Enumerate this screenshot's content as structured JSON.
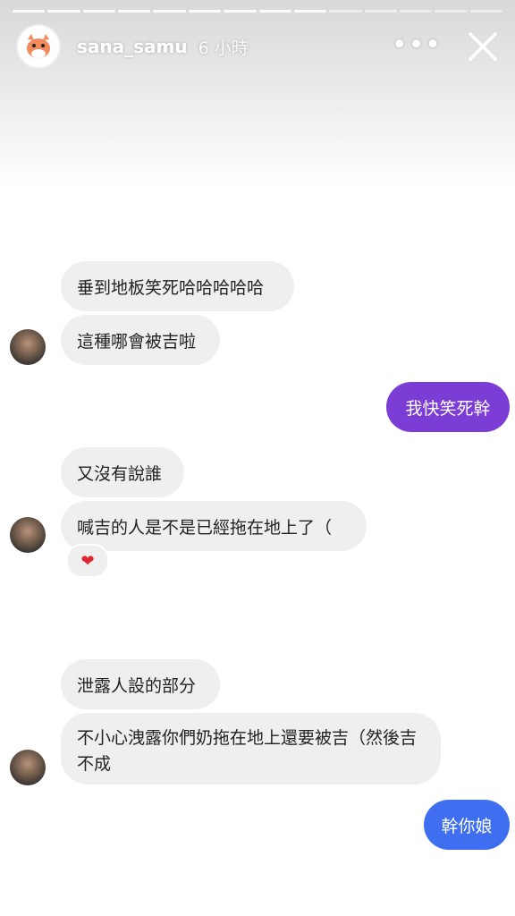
{
  "header": {
    "username": "sana_samu",
    "time": "6 小時",
    "more_label": "•••",
    "close_icon": "close-icon"
  },
  "progress": {
    "total": 14,
    "completed": 9
  },
  "messages": [
    {
      "text": "垂到地板笑死哈哈哈哈哈"
    },
    {
      "text": "這種哪會被吉啦"
    },
    {
      "text": "我快笑死幹"
    },
    {
      "text": "又沒有說誰"
    },
    {
      "text": "喊吉的人是不是已經拖在地上了（"
    },
    {
      "text": "泄露人設的部分"
    },
    {
      "text": "不小心洩露你們奶拖在地上還要被吉（然後吉不成"
    },
    {
      "text": "幹你娘"
    }
  ],
  "reaction": {
    "emoji": "❤"
  },
  "colors": {
    "incoming": "#efefef",
    "outgoing_purple": "#7b3dd6",
    "outgoing_blue": "#3f6ff0"
  }
}
